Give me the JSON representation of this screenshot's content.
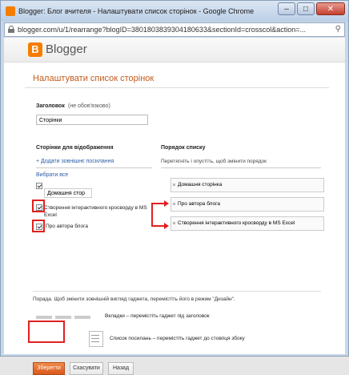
{
  "window": {
    "title": "Blogger: Блог вчителя - Налаштувати список сторінок - Google Chrome",
    "url": "blogger.com/u/1/rearrange?blogID=3801803839304180633&sectionId=crosscol&action=...",
    "minimize": "–",
    "maximize": "□",
    "close": "✕"
  },
  "header": {
    "logo_letter": "B",
    "brand": "Blogger"
  },
  "page": {
    "heading": "Налаштувати список сторінок"
  },
  "form": {
    "title_label": "Заголовок",
    "title_hint": "(не обов'язково)",
    "title_value": "Сторінки"
  },
  "left": {
    "header": "Сторінки для відображення",
    "add_link": "+ Додати зовнішнє посилання",
    "select_all": "Вибрати все",
    "items": [
      "Домашня стор",
      "Створення інтерактивного кросворду в MS Ехсеl",
      "Про автора блога"
    ]
  },
  "right": {
    "header": "Порядок списку",
    "hint": "Перетягніть і опустіть, щоб змінити порядок",
    "items": [
      "Домашня сторінка",
      "Про автора блога",
      "Створення інтерактивного кросворду в MS Ехсеl"
    ]
  },
  "tips": {
    "tip": "Порада. Щоб змінити зовнішній вигляд гаджета, перемістіть його в режим \"Дизайн\".",
    "tabs": "Вкладки – перемістіть гаджет під заголовок",
    "list": "Список посилань – перемістіть гаджет до стовпця збоку"
  },
  "buttons": {
    "save": "Зберегти",
    "cancel": "Скасувати",
    "back": "Назад"
  },
  "colors": {
    "accent": "#f57d00",
    "heading": "#c35a1b",
    "link": "#2b5ea8",
    "annotation": "#e02020"
  }
}
